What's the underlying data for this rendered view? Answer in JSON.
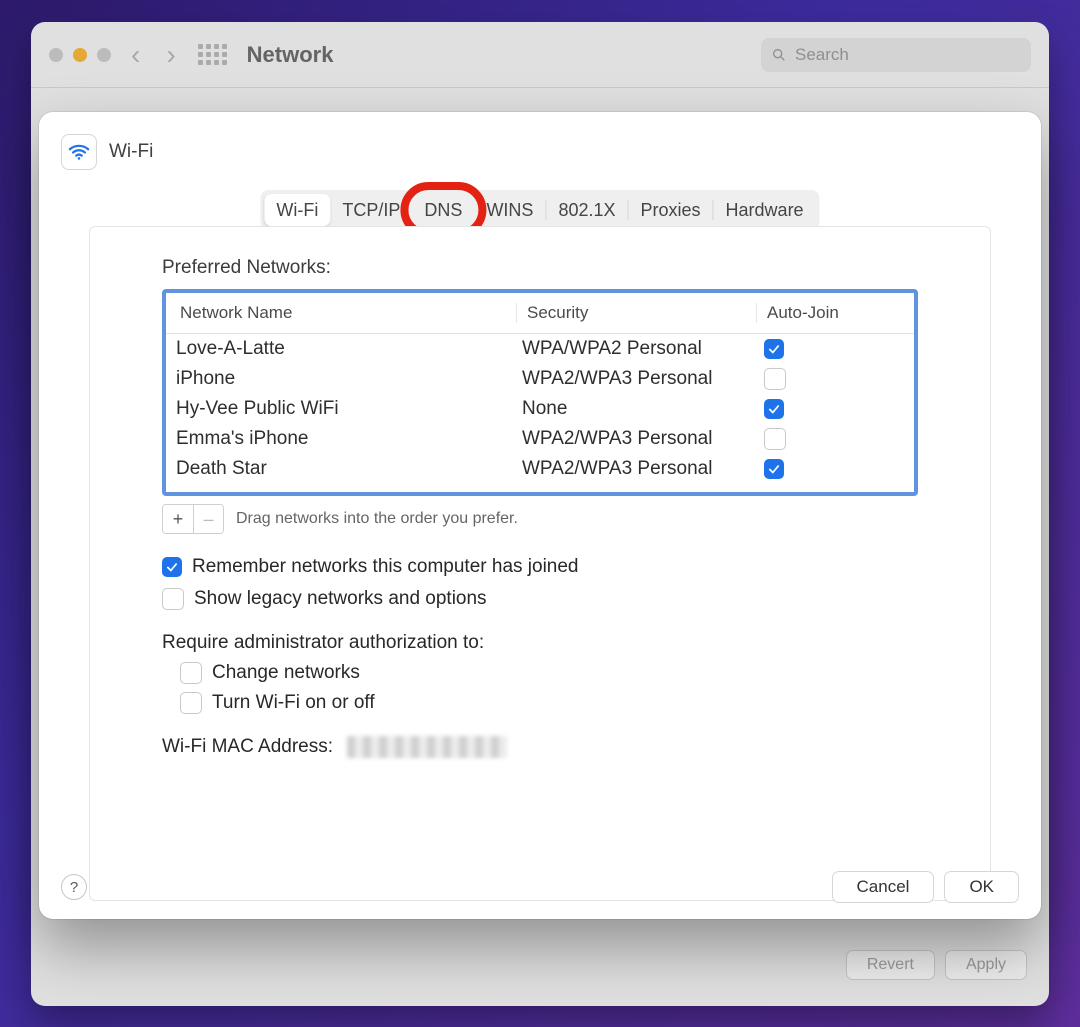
{
  "window": {
    "title": "Network",
    "search_placeholder": "Search"
  },
  "sheet": {
    "title": "Wi-Fi"
  },
  "tabs": [
    "Wi-Fi",
    "TCP/IP",
    "DNS",
    "WINS",
    "802.1X",
    "Proxies",
    "Hardware"
  ],
  "tabs_selected_index": 0,
  "tabs_annotated_index": 2,
  "preferred_label": "Preferred Networks:",
  "columns": {
    "name": "Network Name",
    "security": "Security",
    "auto": "Auto-Join"
  },
  "networks": [
    {
      "name": "Love-A-Latte",
      "security": "WPA/WPA2 Personal",
      "auto": true
    },
    {
      "name": "iPhone",
      "security": "WPA2/WPA3 Personal",
      "auto": false
    },
    {
      "name": "Hy-Vee Public WiFi",
      "security": "None",
      "auto": true
    },
    {
      "name": "Emma's iPhone",
      "security": "WPA2/WPA3 Personal",
      "auto": false
    },
    {
      "name": "Death Star",
      "security": "WPA2/WPA3 Personal",
      "auto": true
    }
  ],
  "drag_hint": "Drag networks into the order you prefer.",
  "remember": {
    "label": "Remember networks this computer has joined",
    "checked": true
  },
  "legacy": {
    "label": "Show legacy networks and options",
    "checked": false
  },
  "require_label": "Require administrator authorization to:",
  "req_change": {
    "label": "Change networks",
    "checked": false
  },
  "req_toggle": {
    "label": "Turn Wi-Fi on or off",
    "checked": false
  },
  "mac_label": "Wi-Fi MAC Address:",
  "buttons": {
    "cancel": "Cancel",
    "ok": "OK",
    "revert": "Revert",
    "apply": "Apply",
    "plus": "+",
    "minus": "–"
  },
  "colors": {
    "accent": "#1e72ea",
    "annotation": "#e42214"
  }
}
